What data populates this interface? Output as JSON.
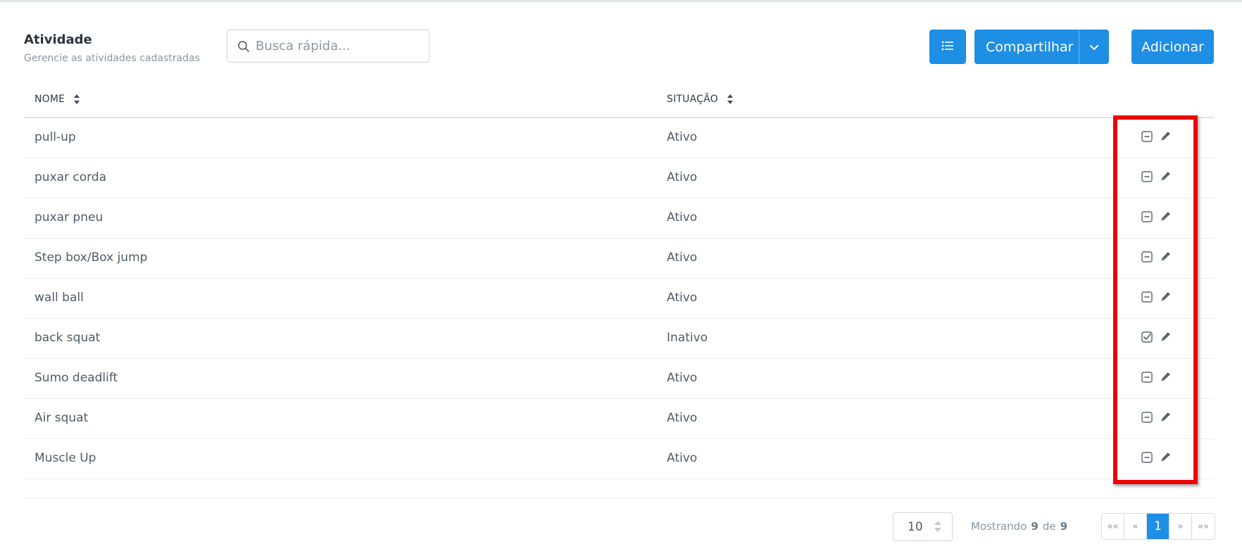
{
  "header": {
    "title": "Atividade",
    "subtitle": "Gerencie as atividades cadastradas"
  },
  "search": {
    "placeholder": "Busca rápida..."
  },
  "toolbar": {
    "list_icon": "list-icon",
    "share_label": "Compartilhar",
    "add_label": "Adicionar"
  },
  "table": {
    "columns": [
      {
        "label": "NOME"
      },
      {
        "label": "SITUAÇÃO"
      }
    ],
    "rows": [
      {
        "name": "pull-up",
        "status": "Ativo",
        "toggle": "minus-square-icon"
      },
      {
        "name": "puxar corda",
        "status": "Ativo",
        "toggle": "minus-square-icon"
      },
      {
        "name": "puxar pneu",
        "status": "Ativo",
        "toggle": "minus-square-icon"
      },
      {
        "name": "Step box/Box jump",
        "status": "Ativo",
        "toggle": "minus-square-icon"
      },
      {
        "name": "wall ball",
        "status": "Ativo",
        "toggle": "minus-square-icon"
      },
      {
        "name": "back squat",
        "status": "Inativo",
        "toggle": "check-square-icon"
      },
      {
        "name": "Sumo deadlift",
        "status": "Ativo",
        "toggle": "minus-square-icon"
      },
      {
        "name": "Air squat",
        "status": "Ativo",
        "toggle": "minus-square-icon"
      },
      {
        "name": "Muscle Up",
        "status": "Ativo",
        "toggle": "minus-square-icon"
      }
    ]
  },
  "footer": {
    "page_size": "10",
    "showing_label": "Mostrando",
    "showing_count": "9",
    "of_label": "de",
    "total": "9",
    "pager": {
      "first": "««",
      "prev": "«",
      "current": "1",
      "next": "»",
      "last": "»»"
    }
  },
  "colors": {
    "primary": "#1f8ee5",
    "highlight": "#f00000"
  }
}
